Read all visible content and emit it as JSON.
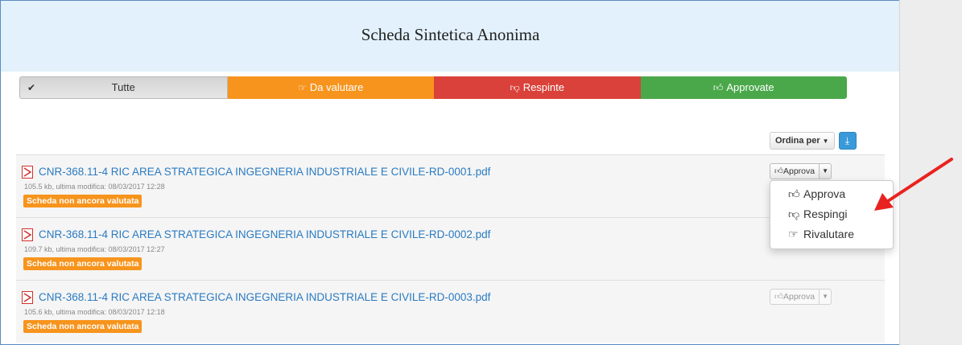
{
  "header": {
    "title": "Scheda Sintetica Anonima"
  },
  "tabs": [
    {
      "label": "Tutte",
      "icon": "check-icon",
      "selected": true
    },
    {
      "label": "Da valutare",
      "icon": "thumbs-right-icon",
      "color": "#f7941d"
    },
    {
      "label": "Respinte",
      "icon": "thumbs-down-icon",
      "color": "#d9413a"
    },
    {
      "label": "Approvate",
      "icon": "thumbs-up-icon",
      "color": "#4aa84a"
    }
  ],
  "toolbar": {
    "sort_label": "Ordina per",
    "download_icon": "download-icon"
  },
  "files": [
    {
      "name": "CNR-368.11-4 RIC AREA STRATEGICA INGEGNERIA INDUSTRIALE E CIVILE-RD-0001.pdf",
      "meta": "105.5 kb, ultima modifica: 08/03/2017 12:28",
      "status": "Scheda non ancora valutata",
      "action": "Approva"
    },
    {
      "name": "CNR-368.11-4 RIC AREA STRATEGICA INGEGNERIA INDUSTRIALE E CIVILE-RD-0002.pdf",
      "meta": "109.7 kb, ultima modifica: 08/03/2017 12:27",
      "status": "Scheda non ancora valutata",
      "action": "Approva"
    },
    {
      "name": "CNR-368.11-4 RIC AREA STRATEGICA INGEGNERIA INDUSTRIALE E CIVILE-RD-0003.pdf",
      "meta": "105.6 kb, ultima modifica: 08/03/2017 12:18",
      "status": "Scheda non ancora valutata",
      "action": "Approva"
    }
  ],
  "dropdown": {
    "items": [
      {
        "label": "Approva",
        "icon": "thumbs-up-icon"
      },
      {
        "label": "Respingi",
        "icon": "thumbs-down-icon"
      },
      {
        "label": "Rivalutare",
        "icon": "thumbs-right-icon"
      }
    ]
  },
  "colors": {
    "header_bg": "#e2f1fb",
    "link": "#2a7bc2",
    "badge": "#f7941d",
    "annotation_arrow": "#e8231f"
  }
}
